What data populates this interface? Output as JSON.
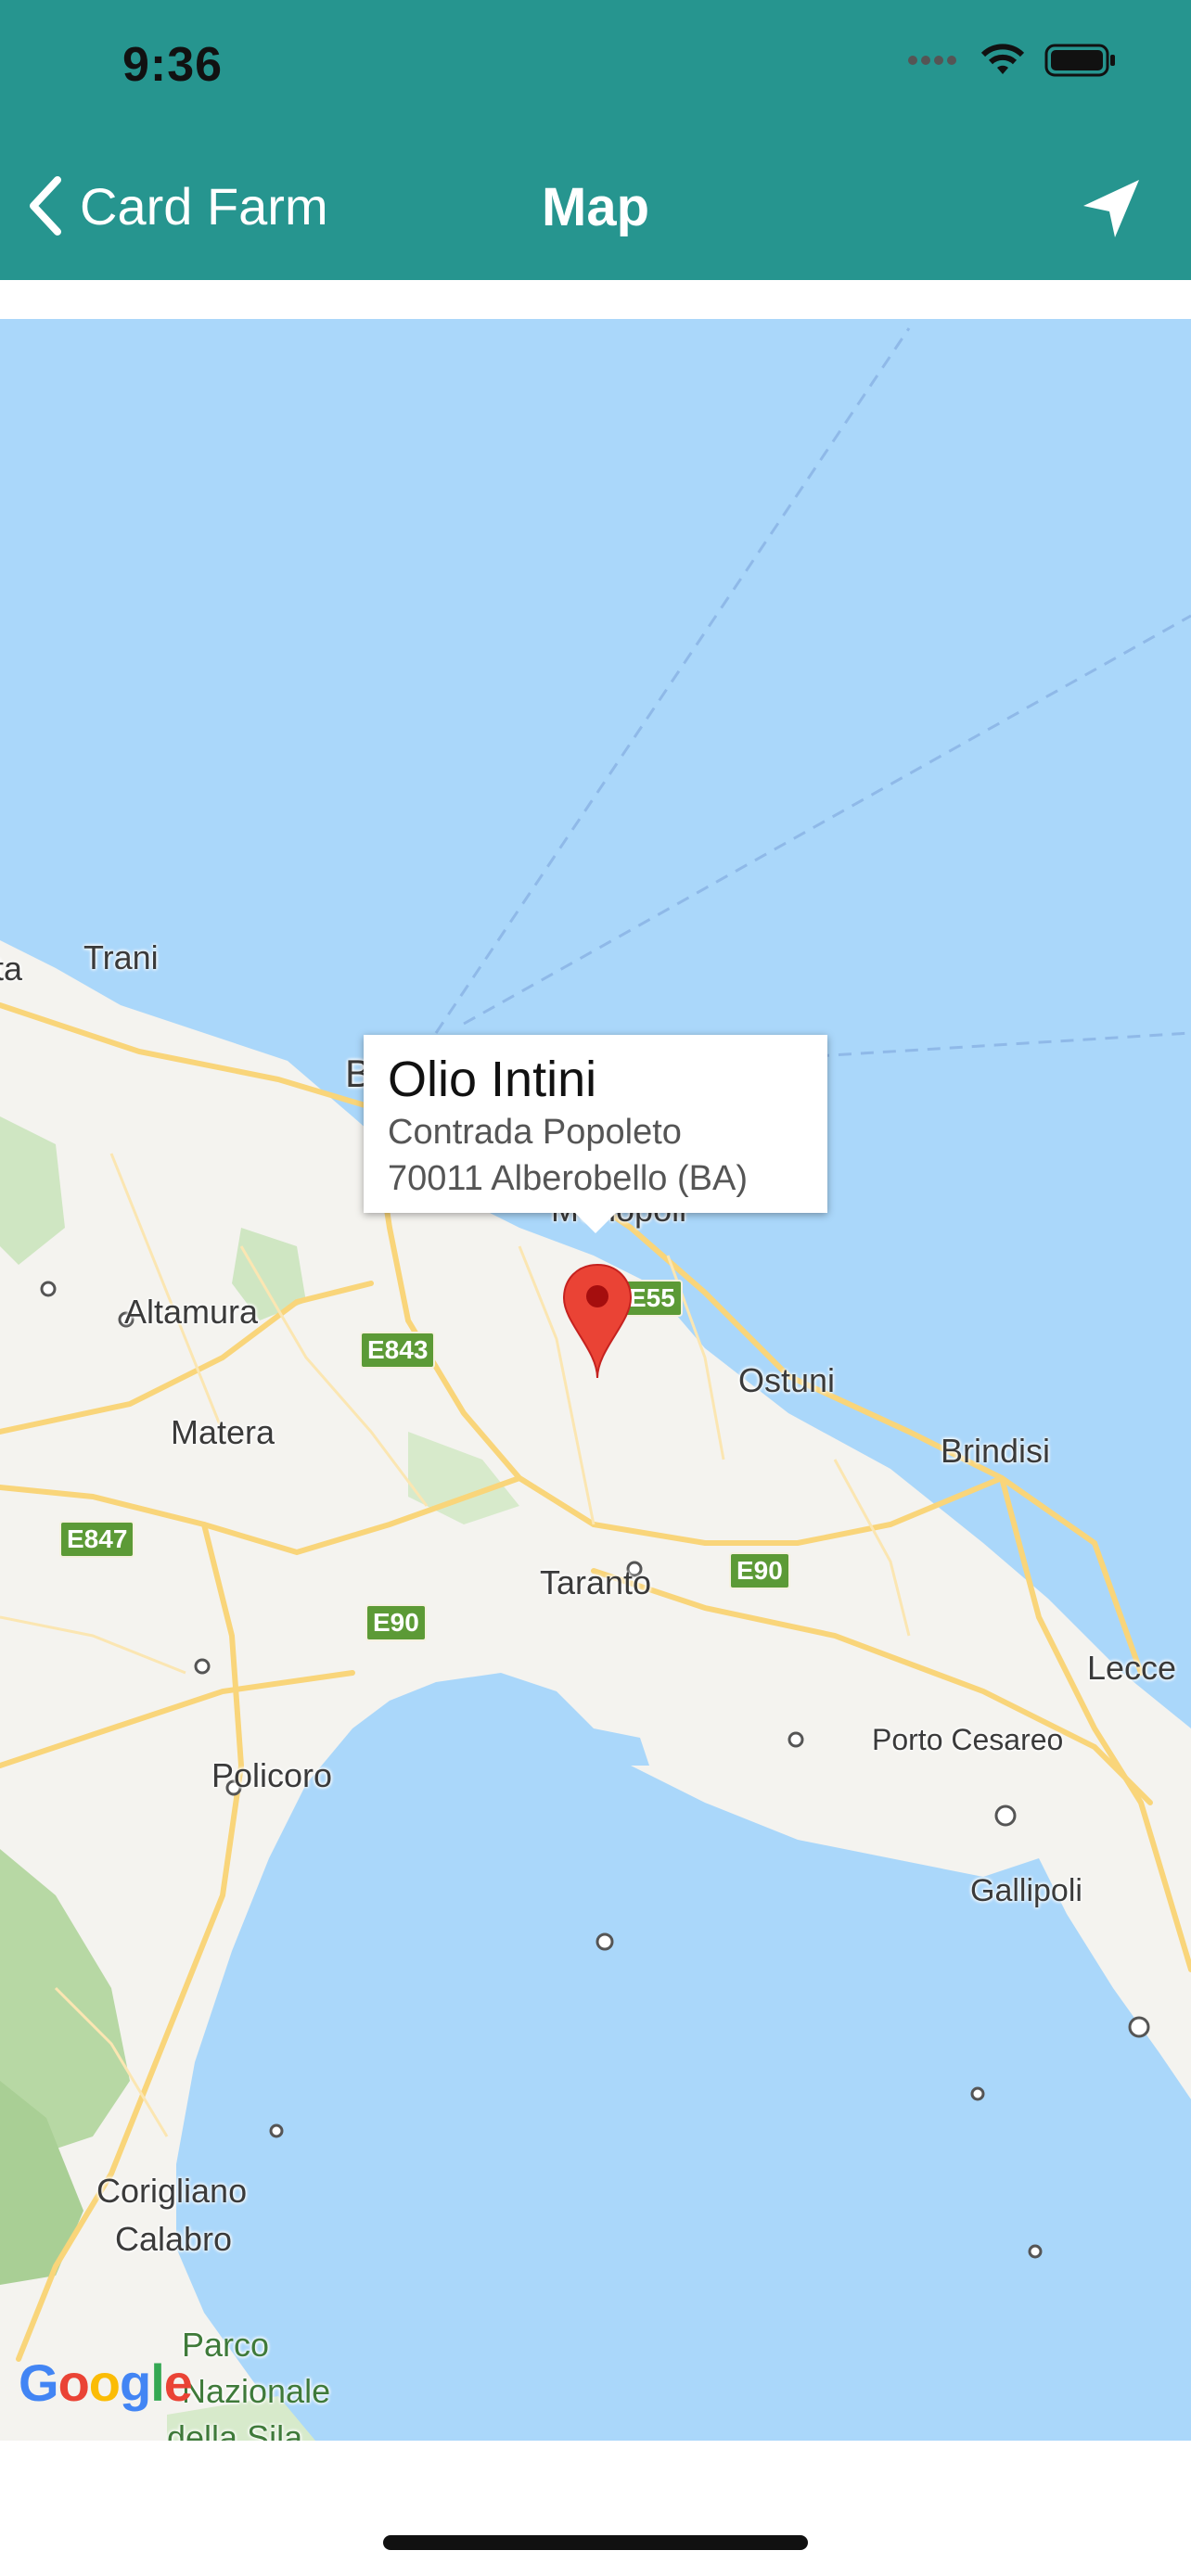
{
  "status_bar": {
    "time": "9:36"
  },
  "nav": {
    "back_label": "Card Farm",
    "title": "Map"
  },
  "info_window": {
    "title": "Olio Intini",
    "line1": "Contrada Popoleto",
    "line2": "70011 Alberobello (BA)"
  },
  "places": {
    "ta": "ta",
    "trani": "Trani",
    "b": "B",
    "monopoli": "Monopoli",
    "altamura": "Altamura",
    "matera": "Matera",
    "ostuni": "Ostuni",
    "brindisi": "Brindisi",
    "taranto": "Taranto",
    "lecce": "Lecce",
    "porto_cesareo": "Porto Cesareo",
    "policoro": "Policoro",
    "gallipoli": "Gallipoli",
    "corigliano": "Corigliano",
    "calabro": "Calabro",
    "parco": "Parco",
    "nazionale": "Nazionale",
    "della_sila": "della Sila"
  },
  "roads": {
    "e55": "E55",
    "e843": "E843",
    "e847": "E847",
    "e90_west": "E90",
    "e90_east": "E90"
  },
  "map": {
    "logo": "Google"
  },
  "colors": {
    "header": "#26958f",
    "sea": "#aad7fa",
    "land": "#f4f3ef",
    "marker": "#ea4335"
  }
}
